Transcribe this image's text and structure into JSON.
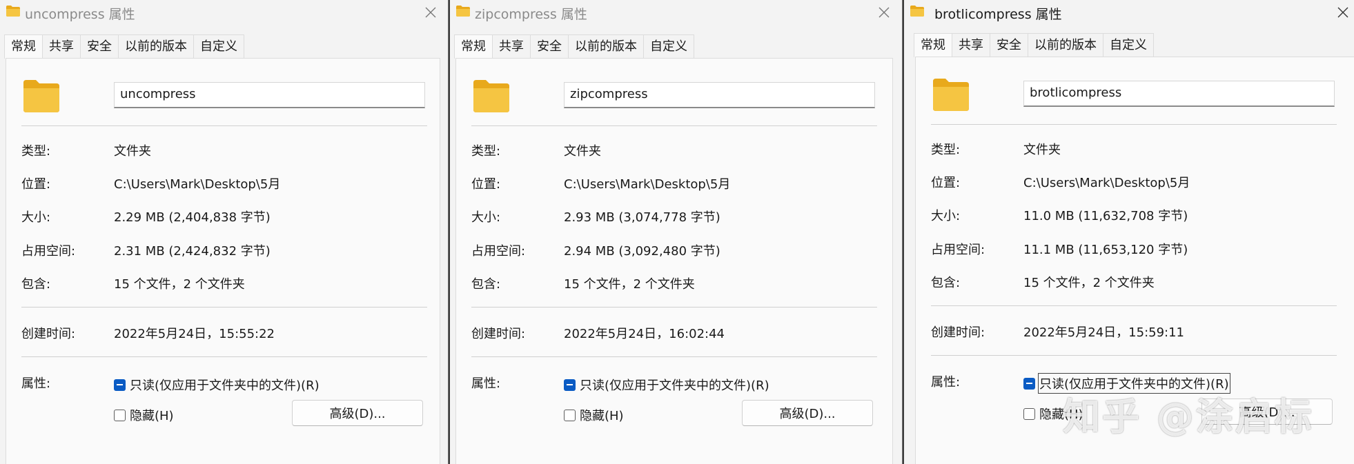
{
  "tabs": [
    "常规",
    "共享",
    "安全",
    "以前的版本",
    "自定义"
  ],
  "labels": {
    "type": "类型:",
    "location": "位置:",
    "size": "大小:",
    "size_on_disk": "占用空间:",
    "contains": "包含:",
    "created": "创建时间:",
    "attributes": "属性:"
  },
  "checkboxes": {
    "readonly": "只读(仅应用于文件夹中的文件)(R)",
    "hidden": "隐藏(H)"
  },
  "advanced_button": "高级(D)...",
  "windows": [
    {
      "title": "uncompress 属性",
      "name": "uncompress",
      "type": "文件夹",
      "location": "C:\\Users\\Mark\\Desktop\\5月",
      "size": "2.29 MB (2,404,838 字节)",
      "size_on_disk": "2.31 MB (2,424,832 字节)",
      "contains": "15 个文件，2 个文件夹",
      "created": "2022年5月24日，15:55:22"
    },
    {
      "title": "zipcompress 属性",
      "name": "zipcompress",
      "type": "文件夹",
      "location": "C:\\Users\\Mark\\Desktop\\5月",
      "size": "2.93 MB (3,074,778 字节)",
      "size_on_disk": "2.94 MB (3,092,480 字节)",
      "contains": "15 个文件，2 个文件夹",
      "created": "2022年5月24日，16:02:44"
    },
    {
      "title": "brotlicompress 属性",
      "name": "brotlicompress",
      "type": "文件夹",
      "location": "C:\\Users\\Mark\\Desktop\\5月",
      "size": "11.0 MB (11,632,708 字节)",
      "size_on_disk": "11.1 MB (11,653,120 字节)",
      "contains": "15 个文件，2 个文件夹",
      "created": "2022年5月24日，15:59:11"
    }
  ],
  "watermark": "知乎 @涂启标",
  "colors": {
    "accent": "#0a5bc4",
    "folder": "#f5c542",
    "folder_dark": "#e8a91c"
  }
}
